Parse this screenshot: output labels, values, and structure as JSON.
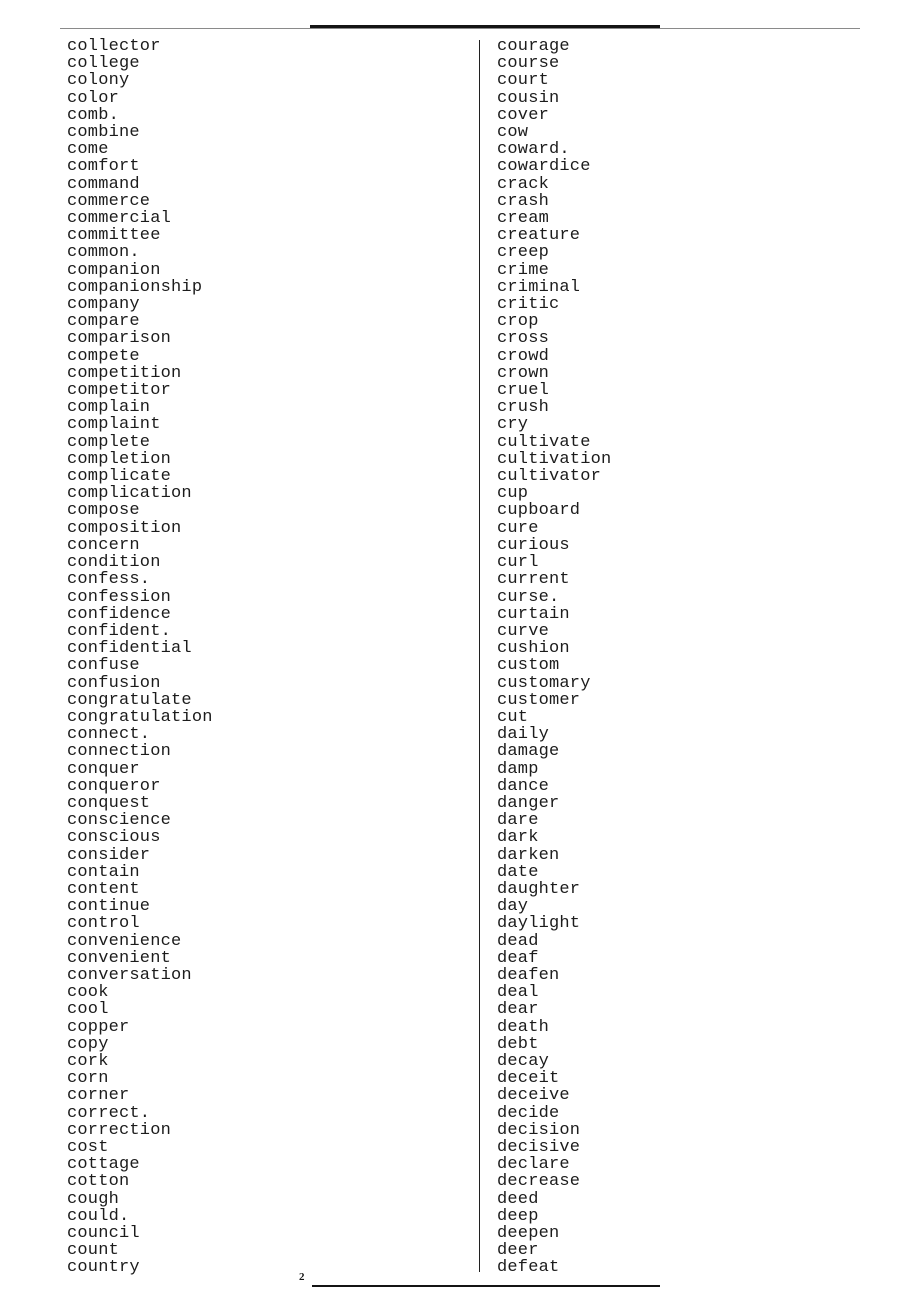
{
  "document": {
    "page_number": "2",
    "type": "two-column-word-list"
  },
  "columns": {
    "left": {
      "words": [
        "collector",
        "college",
        "colony",
        "color",
        "comb.",
        "combine",
        "come",
        "comfort",
        "command",
        "commerce",
        "commercial",
        "committee",
        "common.",
        "companion",
        "companionship",
        "company",
        "compare",
        "comparison",
        "compete",
        "competition",
        "competitor",
        "complain",
        "complaint",
        "complete",
        "completion",
        "complicate",
        "complication",
        "compose",
        "composition",
        "concern",
        "condition",
        "confess.",
        "confession",
        "confidence",
        "confident.",
        "confidential",
        "confuse",
        "confusion",
        "congratulate",
        "congratulation",
        "connect.",
        "connection",
        "conquer",
        "conqueror",
        "conquest",
        "conscience",
        "conscious",
        "consider",
        "contain",
        "content",
        "continue",
        "control",
        "convenience",
        "convenient",
        "conversation",
        "cook",
        "cool",
        "copper",
        "copy",
        "cork",
        "corn",
        "corner",
        "correct.",
        "correction",
        "cost",
        "cottage",
        "cotton",
        "cough",
        "could.",
        "council",
        "count",
        "country"
      ]
    },
    "right": {
      "words": [
        "courage",
        "course",
        "court",
        "cousin",
        "cover",
        "cow",
        "coward.",
        "cowardice",
        "crack",
        "crash",
        "cream",
        "creature",
        "creep",
        "crime",
        "criminal",
        "critic",
        "crop",
        "cross",
        "crowd",
        "crown",
        "cruel",
        "crush",
        "cry",
        "cultivate",
        "cultivation",
        "cultivator",
        "cup",
        "cupboard",
        "cure",
        "curious",
        "curl",
        "current",
        "curse.",
        "curtain",
        "curve",
        "cushion",
        "custom",
        "customary",
        "customer",
        "cut",
        "daily",
        "damage",
        "damp",
        "dance",
        "danger",
        "dare",
        "dark",
        "darken",
        "date",
        "daughter",
        "day",
        "daylight",
        "dead",
        "deaf",
        "deafen",
        "deal",
        "dear",
        "death",
        "debt",
        "decay",
        "deceit",
        "deceive",
        "decide",
        "decision",
        "decisive",
        "declare",
        "decrease",
        "deed",
        "deep",
        "deepen",
        "deer",
        "defeat"
      ]
    }
  }
}
